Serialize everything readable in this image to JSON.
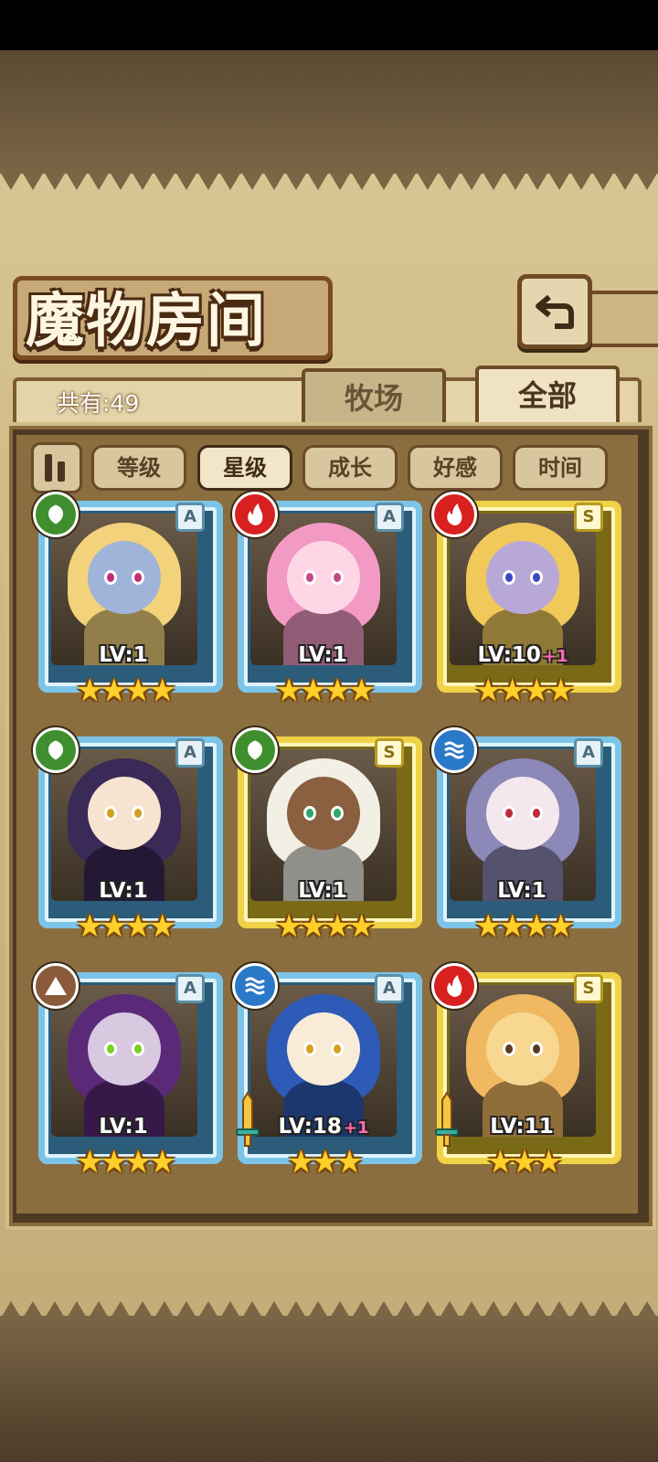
{
  "title": "魔物房间",
  "count_text": "共有:49",
  "tabs": {
    "pasture": "牧场",
    "all": "全部"
  },
  "filters": [
    "等级",
    "星级",
    "成长",
    "好感",
    "时间"
  ],
  "active_filter": "星级",
  "colors": {
    "nature": "#3f8f2e",
    "fire": "#d82020",
    "water": "#2a78c8",
    "earth": "#8a5a3a",
    "frame_blue": "#7cc3e8",
    "frame_gold": "#f0d246"
  },
  "monsters": [
    {
      "element": "nature",
      "grade": "A",
      "level": "LV:1",
      "plus": "",
      "stars": "★★★★",
      "frame": "blue",
      "tone": "#9fb4d8",
      "hair": "#f2d27a",
      "eye": "#c0307a"
    },
    {
      "element": "fire",
      "grade": "A",
      "level": "LV:1",
      "plus": "",
      "stars": "★★★★",
      "frame": "blue",
      "tone": "#ffd6e6",
      "hair": "#f29ac4",
      "eye": "#c04a8a"
    },
    {
      "element": "fire",
      "grade": "S",
      "level": "LV:10",
      "plus": "+1",
      "stars": "★★★★",
      "frame": "gold",
      "tone": "#b7a8d8",
      "hair": "#f0c95a",
      "eye": "#3a4ac0"
    },
    {
      "element": "nature",
      "grade": "A",
      "level": "LV:1",
      "plus": "",
      "stars": "★★★★",
      "frame": "blue",
      "tone": "#f6e4d0",
      "hair": "#3a2a58",
      "eye": "#d0a020"
    },
    {
      "element": "nature",
      "grade": "S",
      "level": "LV:1",
      "plus": "",
      "stars": "★★★★",
      "frame": "gold",
      "tone": "#8a6040",
      "hair": "#f2efe4",
      "eye": "#2aa86a"
    },
    {
      "element": "water",
      "grade": "A",
      "level": "LV:1",
      "plus": "",
      "stars": "★★★★",
      "frame": "blue",
      "tone": "#f4e8ee",
      "hair": "#8c88b8",
      "eye": "#c02a3a"
    },
    {
      "element": "earth",
      "grade": "A",
      "level": "LV:1",
      "plus": "",
      "stars": "★★★★",
      "frame": "blue",
      "tone": "#d8c8e0",
      "hair": "#5a2a78",
      "eye": "#7ad020"
    },
    {
      "element": "water",
      "grade": "A",
      "level": "LV:18",
      "plus": "+1",
      "stars": "★★★",
      "frame": "blue",
      "tone": "#f8ecd8",
      "hair": "#2e5ab8",
      "eye": "#d8a020"
    },
    {
      "element": "fire",
      "grade": "S",
      "level": "LV:11",
      "plus": "",
      "stars": "★★★",
      "frame": "gold",
      "tone": "#f8d890",
      "hair": "#f0b860",
      "eye": "#5a3a20"
    }
  ]
}
